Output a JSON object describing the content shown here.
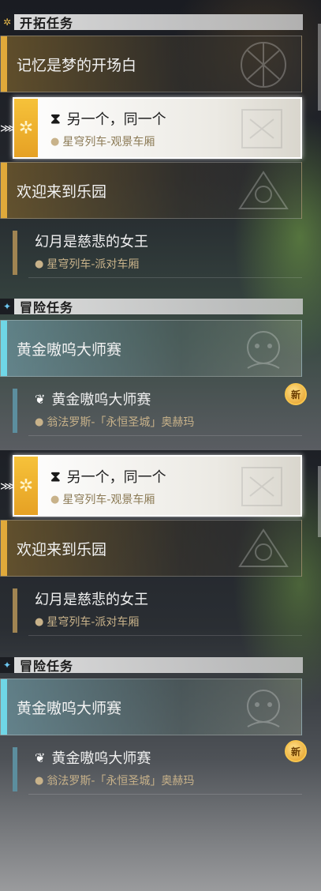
{
  "panel_top": {
    "trailblaze_section": {
      "title": "开拓任务",
      "icon": "trailblaze-icon"
    },
    "quest_memory": {
      "label": "记忆是梦的开场白"
    },
    "selected_mission": {
      "name": "另一个，同一个",
      "location": "星穹列车-观景车厢",
      "icon": "hourglass-icon"
    },
    "quest_welcome": {
      "label": "欢迎来到乐园"
    },
    "sub_illusion": {
      "name": "幻月是慈悲的女王",
      "location": "星穹列车-派对车厢"
    },
    "adventure_section": {
      "title": "冒险任务",
      "icon": "adventure-icon"
    },
    "quest_gold": {
      "label": "黄金嗷呜大师赛"
    },
    "sub_gold": {
      "name": "黄金嗷呜大师赛",
      "location": "翁法罗斯-「永恒圣城」奥赫玛",
      "badge": "新"
    }
  },
  "panel_bottom": {
    "selected_mission": {
      "name": "另一个，同一个",
      "location": "星穹列车-观景车厢"
    },
    "quest_welcome": {
      "label": "欢迎来到乐园"
    },
    "sub_illusion": {
      "name": "幻月是慈悲的女王",
      "location": "星穹列车-派对车厢"
    },
    "adventure_section": {
      "title": "冒险任务"
    },
    "quest_gold": {
      "label": "黄金嗷呜大师赛"
    },
    "sub_gold": {
      "name": "黄金嗷呜大师赛",
      "location": "翁法罗斯-「永恒圣城」奥赫玛",
      "badge": "新"
    }
  },
  "colors": {
    "trailblaze_accent": "#e0a93a",
    "adventure_accent": "#6fd6e6",
    "location_text": "#c8b28a"
  }
}
